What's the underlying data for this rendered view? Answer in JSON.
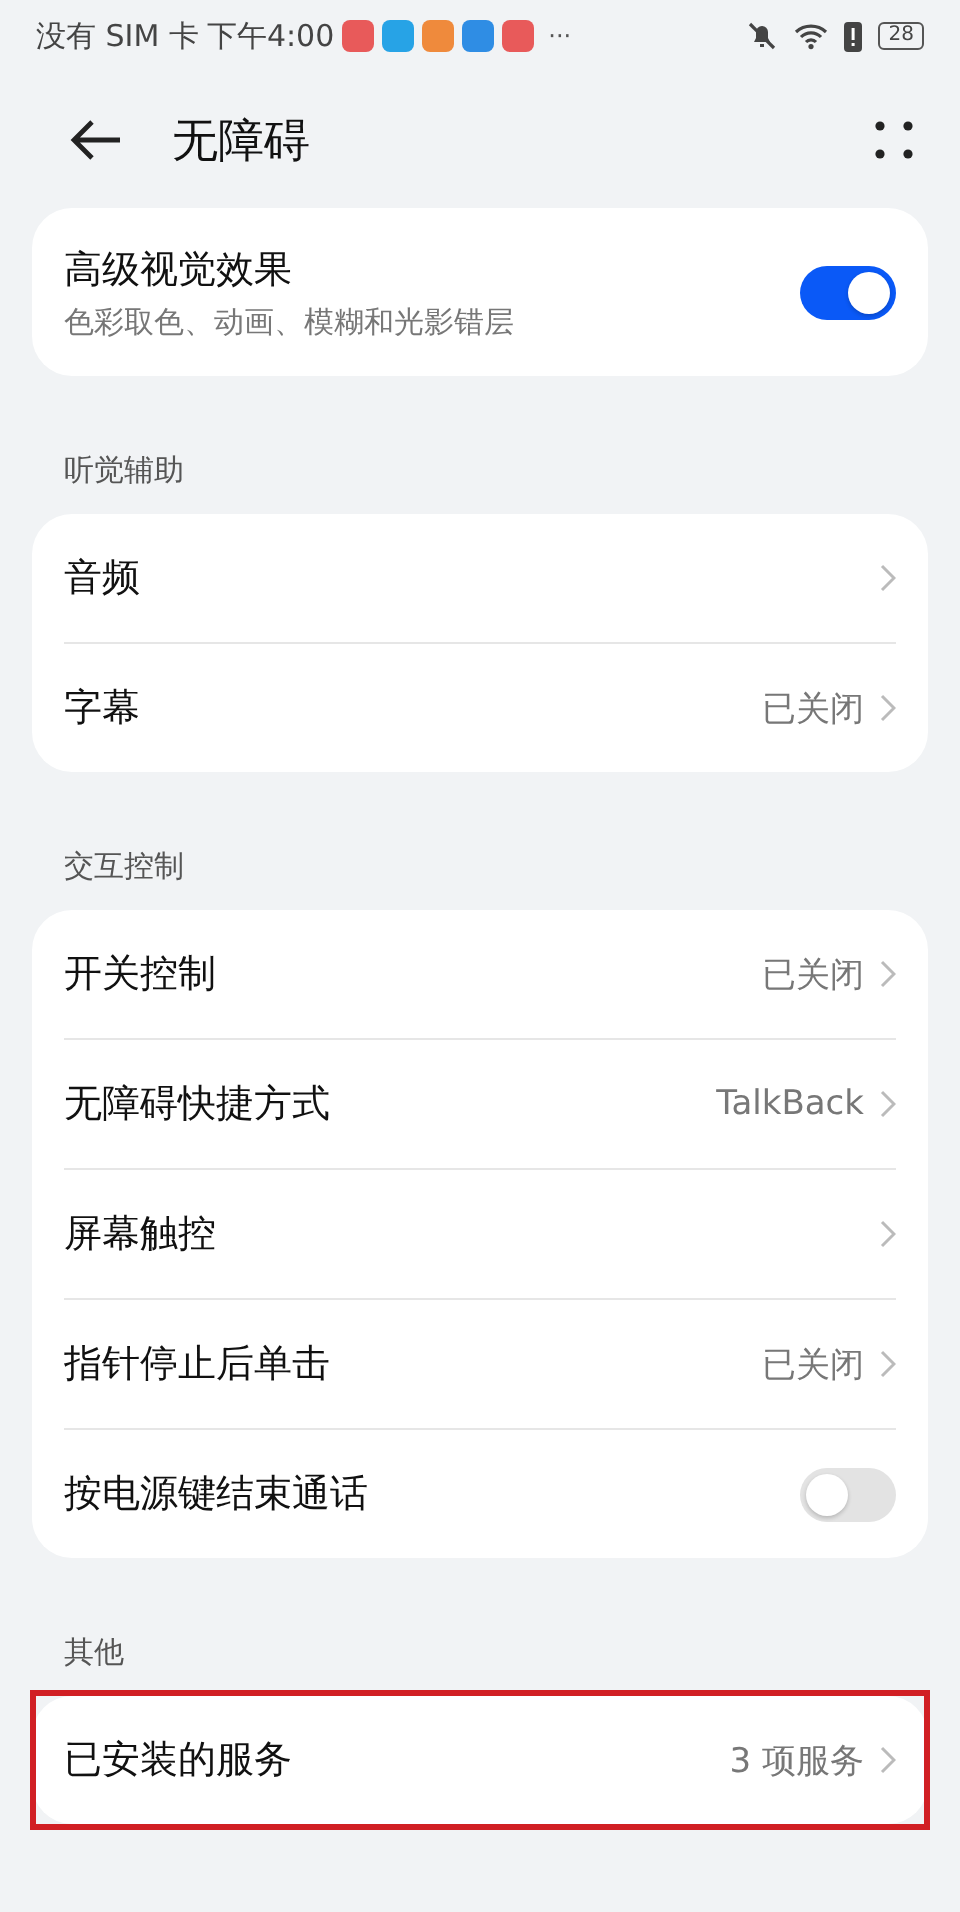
{
  "status_bar": {
    "carrier": "没有 SIM 卡",
    "time": "下午4:00",
    "notifications": [
      {
        "color": "#e85a5a"
      },
      {
        "color": "#27a3e6"
      },
      {
        "color": "#ef8a3c"
      },
      {
        "color": "#2f8de4"
      },
      {
        "color": "#e85a5a"
      }
    ],
    "more": "···",
    "battery": "28"
  },
  "header": {
    "title": "无障碍"
  },
  "sections": [
    {
      "items": [
        {
          "kind": "toggle",
          "label": "高级视觉效果",
          "subtitle": "色彩取色、动画、模糊和光影错层",
          "on": true,
          "highlighted": false
        }
      ]
    },
    {
      "title": "听觉辅助",
      "items": [
        {
          "kind": "link",
          "label": "音频",
          "highlighted": false
        },
        {
          "kind": "link",
          "label": "字幕",
          "value": "已关闭",
          "highlighted": false
        }
      ]
    },
    {
      "title": "交互控制",
      "items": [
        {
          "kind": "link",
          "label": "开关控制",
          "value": "已关闭",
          "highlighted": false
        },
        {
          "kind": "link",
          "label": "无障碍快捷方式",
          "value": "TalkBack",
          "highlighted": false
        },
        {
          "kind": "link",
          "label": "屏幕触控",
          "highlighted": false
        },
        {
          "kind": "link",
          "label": "指针停止后单击",
          "value": "已关闭",
          "highlighted": false
        },
        {
          "kind": "toggle",
          "label": "按电源键结束通话",
          "on": false,
          "highlighted": false
        }
      ]
    },
    {
      "title": "其他",
      "items": [
        {
          "kind": "link",
          "label": "已安装的服务",
          "value": "3 项服务",
          "highlighted": true
        }
      ]
    }
  ]
}
